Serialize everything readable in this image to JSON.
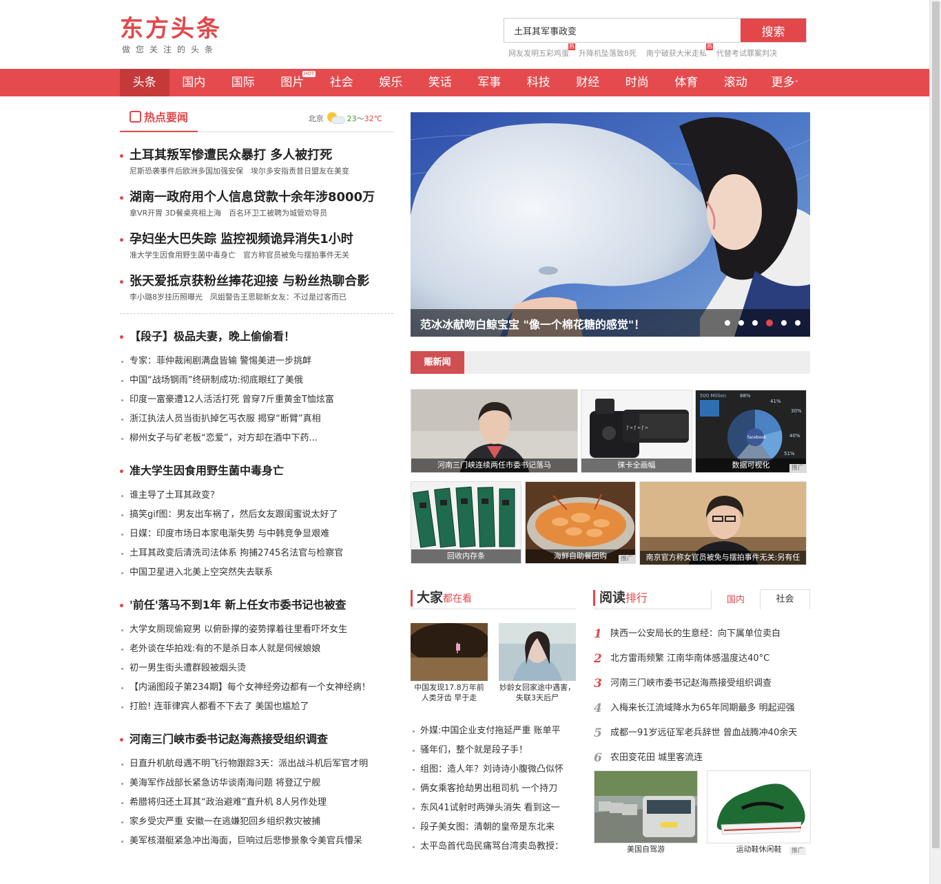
{
  "logo": {
    "title": "东方头条",
    "tagline": "做您关注的头条"
  },
  "search": {
    "value": "土耳其军事政变",
    "button": "搜索"
  },
  "hot_words": [
    {
      "text": "网友发明五彩鸡蛋",
      "tag": "热"
    },
    {
      "text": "升降机坠落致8死",
      "tag": ""
    },
    {
      "text": "南宁破获大米走私",
      "tag": "热"
    },
    {
      "text": "代替考试罪案判决",
      "tag": ""
    }
  ],
  "nav": {
    "items": [
      "头条",
      "国内",
      "国际",
      "图片",
      "社会",
      "娱乐",
      "笑话",
      "军事",
      "科技",
      "财经",
      "时尚",
      "体育",
      "滚动",
      "更多"
    ],
    "hot_badge": "HOT",
    "more_arrow": "˅"
  },
  "hot_section": {
    "title": "热点要闻",
    "weather": {
      "city": "北京",
      "low": "23",
      "sep": "～",
      "high": "32℃"
    }
  },
  "top_news": [
    {
      "headline": "土耳其叛军惨遭民众暴打 多人被打死",
      "subs": [
        "尼斯恐袭事件后欧洲多国加强安保",
        "埃尔多安指责昔日盟友在美变"
      ]
    },
    {
      "headline": "湖南一政府用个人信息贷款十余年涉8000万",
      "subs": [
        "拿VR开胃 3D餐桌亮相上海",
        "百名环卫工被聘为城管劝导员"
      ]
    },
    {
      "headline": "孕妇坐大巴失踪 监控视频诡异消失1小时",
      "subs": [
        "准大学生因食用野生菌中毒身亡",
        "官方称官员被免与摆拍事件无关"
      ]
    },
    {
      "headline": "张天爱抵京获粉丝捧花迎接 与粉丝热聊合影",
      "subs": [
        "李小璐8岁挂历照曝光",
        "凤姐警告王思聪新女友：不过是过客而已"
      ]
    }
  ],
  "sections": [
    {
      "head": "【段子】极品夫妻，晚上偷偷看！",
      "items": [
        "专家：菲仲裁闹剧满盘皆输 警惕美进一步挑衅",
        "中国“战场钢雨”终研制成功:彻底眼红了美俄",
        "印度一富豪遭12人活活打死 曾穿7斤重黄金T恤炫富",
        "浙江执法人员当街扒掉乞丐衣服 揭穿“断臂”真相",
        "柳州女子与矿老板“恋爱”，对方却在酒中下药..."
      ]
    },
    {
      "head": "准大学生因食用野生菌中毒身亡",
      "items": [
        "谁主导了土耳其政变？",
        "搞笑gif图：男友出车祸了，然后女友跟闺蜜说太好了",
        "日媒：印度市场日本家电渐失势 与中韩竞争显艰难",
        "土耳其政变后清洗司法体系 拘捕2745名法官与检察官",
        "中国卫星进入北美上空突然失去联系"
      ]
    },
    {
      "head": "'前任'落马不到1年 新上任女市委书记也被查",
      "items": [
        "大学女厕现偷窥男 以俯卧撑的姿势撑着往里看吓坏女生",
        "老外谈在华拍戏:有的不是杀日本人就是伺候娘娘",
        "初一男生街头遭群殴被烟头烫",
        "【内涵图段子第234期】每个女神经旁边都有一个女神经病！",
        "打脸! 连菲律宾人都看不下去了 美国也尴尬了"
      ]
    },
    {
      "head": "河南三门峡市委书记赵海燕接受组织调查",
      "items": [
        "日直升机航母遇不明飞行物跟踪3天：派出战斗机后军官才明",
        "美海军作战部长紧急访华谈南海问题 将登辽宁舰",
        "希腊将归还土耳其“政治避难”直升机 8人另作处理",
        "家乡受灾严重 安徽一在逃嫌犯回乡组织救灾被捕",
        "美军核潜艇紧急冲出海面，巨响过后悲惨景象令美官兵懵呆"
      ]
    }
  ],
  "carousel": {
    "caption": "范冰冰献吻白鲸宝宝 \"像一个棉花糖的感觉\"！",
    "slides": 6,
    "active": 4
  },
  "hui_news": {
    "tab": "赈新闻"
  },
  "thumbs": [
    {
      "caption": "河南三门峡连续两任市委书记落马",
      "ad": ""
    },
    {
      "caption": "徕卡全画幅",
      "ad": ""
    },
    {
      "caption": "数据可视化",
      "ad": "推广"
    },
    {
      "caption": "回收内存条",
      "ad": ""
    },
    {
      "caption": "海鲜自助餐团购",
      "ad": "推广"
    },
    {
      "caption": "南京官方称女官员被免与摆拍事件无关:另有任",
      "ad": ""
    }
  ],
  "chart_widget": {
    "top_text": "500 Million",
    "pct_a": "88%",
    "pct_b": "41%",
    "pct_c": "30%",
    "pct_d": "40%",
    "pct_e": "51%",
    "center": "facebook"
  },
  "dajia": {
    "title": "大家",
    "title_em": "都在看",
    "pics": [
      {
        "caption": "中国发现17.8万年前人类牙齿 早于走"
      },
      {
        "caption": "妙龄女回家途中遇害，失联3天后尸"
      }
    ],
    "items": [
      "外媒:中国企业支付拖延严重 账单平",
      "骚年们，整个就是段子手！",
      "组图：造人年？刘诗诗小腹微凸似怀",
      "俩女乘客抢劫男出租司机 一个持刀",
      "东风41试射时两弹头消失 看到这一",
      "段子美女图：清朝的皇帝是东北来",
      "太平岛首代岛民痛骂台湾卖岛教授："
    ]
  },
  "reading": {
    "title": "阅读",
    "title_em": "排行",
    "tabs": [
      "国内",
      "社会"
    ],
    "items": [
      {
        "num": "1",
        "text": "陕西一公安局长的生意经：向下属单位卖白"
      },
      {
        "num": "2",
        "text": "北方雷雨频繁 江南华南体感温度达40°C"
      },
      {
        "num": "3",
        "text": "河南三门峡市委书记赵海燕接受组织调查"
      },
      {
        "num": "4",
        "text": "入梅来长江流域降水为65年同期最多 明起迎强"
      },
      {
        "num": "5",
        "text": "成都一91岁远征军老兵辞世 曾血战腾冲40余天"
      },
      {
        "num": "6",
        "text": "农田变花田 城里客流连"
      }
    ],
    "pics": [
      {
        "caption": "美国自驾游"
      },
      {
        "caption": "运动鞋休闲鞋"
      }
    ],
    "ad": "推广"
  }
}
